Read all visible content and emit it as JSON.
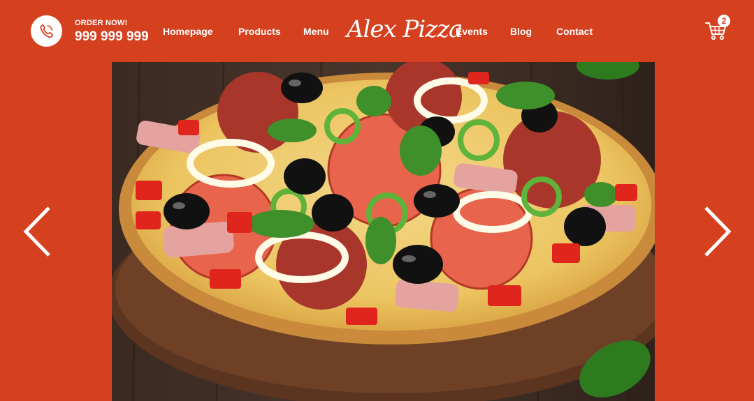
{
  "header": {
    "order_label": "ORDER NOW!",
    "order_phone": "999 999 999",
    "phone_icon": "phone-icon",
    "logo_text": "Alex Pizza",
    "nav": {
      "homepage": "Homepage",
      "products": "Products",
      "menu": "Menu",
      "events": "Events",
      "blog": "Blog",
      "contact": "Contact"
    },
    "cart_icon": "cart-icon",
    "cart_count": "2"
  },
  "slider": {
    "image": "pizza-photo",
    "prev_icon": "chevron-left-icon",
    "next_icon": "chevron-right-icon"
  },
  "colors": {
    "brand": "#d5401f",
    "text": "#ffffff"
  }
}
